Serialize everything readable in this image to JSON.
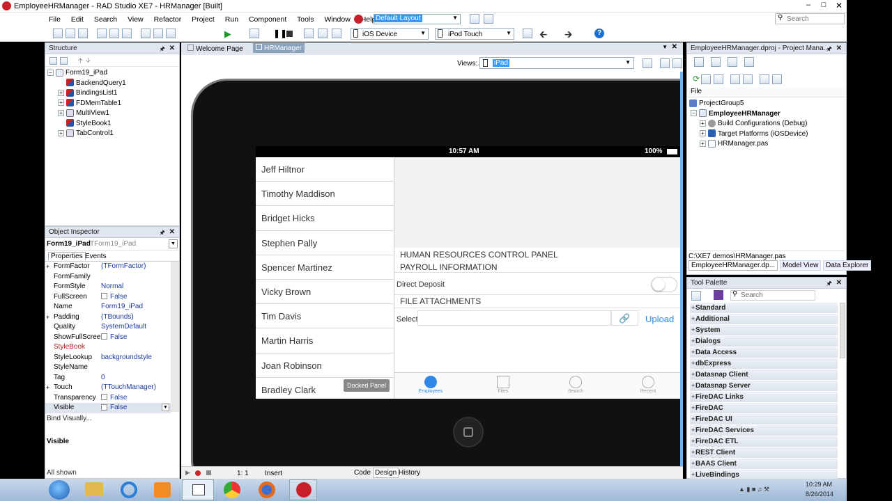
{
  "window": {
    "title": "EmployeeHRManager - RAD Studio XE7 - HRManager [Built]"
  },
  "menu": [
    "File",
    "Edit",
    "Search",
    "View",
    "Refactor",
    "Project",
    "Run",
    "Component",
    "Tools",
    "Window",
    "Help"
  ],
  "layout_select": "Default Layout",
  "search_placeholder": "Search",
  "device1": "iOS Device",
  "device2": "iPod Touch",
  "structure": {
    "title": "Structure",
    "root": "Form19_iPad",
    "items": [
      "BackendQuery1",
      "BindingsList1",
      "FDMemTable1",
      "MultiView1",
      "StyleBook1",
      "TabControl1"
    ]
  },
  "editor_tabs": [
    "Welcome Page",
    "HRManager"
  ],
  "views_label": "Views:",
  "views_value": "iPad",
  "ios": {
    "time": "10:57 AM",
    "battery": "100%"
  },
  "employees": [
    "Jeff Hiltnor",
    "Timothy Maddison",
    "Bridget Hicks",
    "Stephen Pally",
    "Spencer Martinez",
    "Vicky Brown",
    "Tim Davis",
    "Martin Harris",
    "Joan Robinson",
    "Bradley Clark"
  ],
  "docked_panel": "Docked Panel",
  "hr": {
    "h1": "HUMAN RESOURCES CONTROL PANEL",
    "h2": "PAYROLL INFORMATION",
    "direct_deposit": "Direct Deposit",
    "attachments": "FILE ATTACHMENTS",
    "select": "Select",
    "upload": "Upload"
  },
  "app_tabs": [
    "Employees",
    "Files",
    "Search",
    "Recent"
  ],
  "object_inspector": {
    "title": "Object Inspector",
    "component": "Form19_iPad",
    "type": "TForm19_iPad",
    "tabs": [
      "Properties",
      "Events"
    ],
    "props": [
      {
        "k": "FormFactor",
        "v": "(TFormFactor)",
        "exp": true
      },
      {
        "k": "FormFamily",
        "v": ""
      },
      {
        "k": "FormStyle",
        "v": "Normal"
      },
      {
        "k": "FullScreen",
        "v": "False",
        "chk": true
      },
      {
        "k": "Name",
        "v": "Form19_iPad"
      },
      {
        "k": "Padding",
        "v": "(TBounds)",
        "exp": true
      },
      {
        "k": "Quality",
        "v": "SystemDefault"
      },
      {
        "k": "ShowFullScreen",
        "v": "False",
        "chk": true
      },
      {
        "k": "StyleBook",
        "v": "",
        "red": true
      },
      {
        "k": "StyleLookup",
        "v": "backgroundstyle"
      },
      {
        "k": "StyleName",
        "v": ""
      },
      {
        "k": "Tag",
        "v": "0"
      },
      {
        "k": "Touch",
        "v": "(TTouchManager)",
        "exp": true
      },
      {
        "k": "Transparency",
        "v": "False",
        "chk": true
      },
      {
        "k": "Visible",
        "v": "False",
        "chk": true,
        "sel": true
      }
    ],
    "bind_visually": "Bind Visually...",
    "selected_prop": "Visible",
    "all_shown": "All shown"
  },
  "status": {
    "pos": "1:  1",
    "mode": "Insert",
    "tabs": [
      "Code",
      "Design",
      "History"
    ]
  },
  "project_manager": {
    "title": "EmployeeHRManager.dproj - Project Mana...",
    "file_col": "File",
    "group": "ProjectGroup5",
    "project": "EmployeeHRManager",
    "children": [
      "Build Configurations (Debug)",
      "Target Platforms (iOSDevice)",
      "HRManager.pas"
    ],
    "path": "C:\\XE7 demos\\HRManager.pas",
    "tabs": [
      "EmployeeHRManager.dp...",
      "Model View",
      "Data Explorer"
    ]
  },
  "tool_palette": {
    "title": "Tool Palette",
    "search": "Search",
    "categories": [
      "Standard",
      "Additional",
      "System",
      "Dialogs",
      "Data Access",
      "dbExpress",
      "Datasnap Client",
      "Datasnap Server",
      "FireDAC Links",
      "FireDAC",
      "FireDAC UI",
      "FireDAC Services",
      "FireDAC ETL",
      "REST Client",
      "BAAS Client",
      "LiveBindings"
    ]
  },
  "clock": {
    "time": "10:29 AM",
    "date": "8/26/2014"
  }
}
